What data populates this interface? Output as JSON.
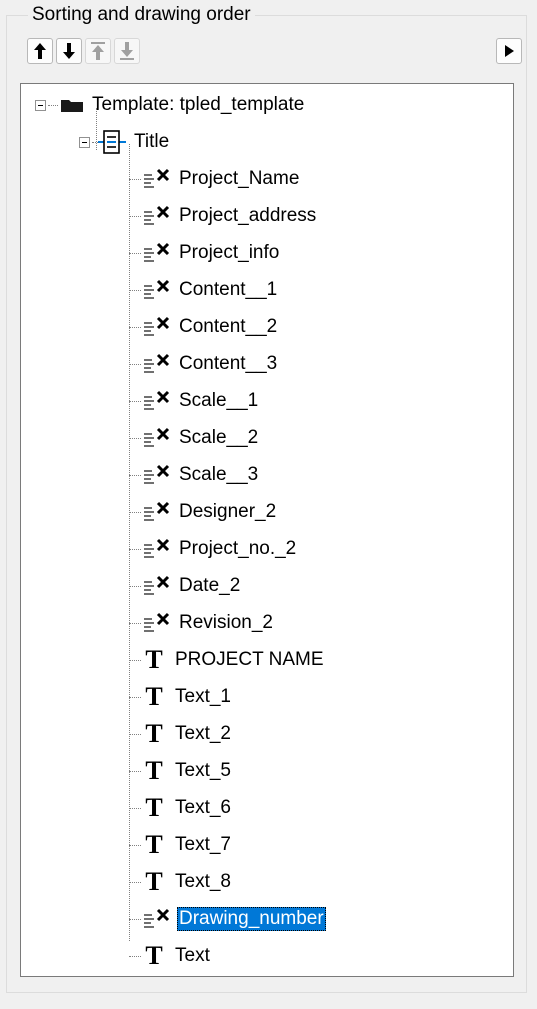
{
  "group": {
    "title": "Sorting and drawing order"
  },
  "toolbar": {
    "buttons": [
      {
        "name": "move-up-button",
        "icon": "arrow-up-icon",
        "enabled": true
      },
      {
        "name": "move-down-button",
        "icon": "arrow-down-icon",
        "enabled": true
      },
      {
        "name": "move-to-top-button",
        "icon": "arrow-to-top-icon",
        "enabled": false
      },
      {
        "name": "move-to-bottom-button",
        "icon": "arrow-to-bottom-icon",
        "enabled": false
      },
      {
        "name": "more-button",
        "icon": "play-right-icon",
        "enabled": true
      }
    ]
  },
  "tree": {
    "root": {
      "label": "Template: tpled_template",
      "icon": "folder-icon",
      "expanded": true
    },
    "title_node": {
      "label": "Title",
      "icon": "block-icon",
      "expanded": true
    },
    "items": [
      {
        "label": "Project_Name",
        "type": "field"
      },
      {
        "label": "Project_address",
        "type": "field"
      },
      {
        "label": "Project_info",
        "type": "field"
      },
      {
        "label": "Content__1",
        "type": "field"
      },
      {
        "label": "Content__2",
        "type": "field"
      },
      {
        "label": "Content__3",
        "type": "field"
      },
      {
        "label": "Scale__1",
        "type": "field"
      },
      {
        "label": "Scale__2",
        "type": "field"
      },
      {
        "label": "Scale__3",
        "type": "field"
      },
      {
        "label": "Designer_2",
        "type": "field"
      },
      {
        "label": "Project_no._2",
        "type": "field"
      },
      {
        "label": "Date_2",
        "type": "field"
      },
      {
        "label": "Revision_2",
        "type": "field"
      },
      {
        "label": "PROJECT NAME",
        "type": "text"
      },
      {
        "label": "Text_1",
        "type": "text"
      },
      {
        "label": "Text_2",
        "type": "text"
      },
      {
        "label": "Text_5",
        "type": "text"
      },
      {
        "label": "Text_6",
        "type": "text"
      },
      {
        "label": "Text_7",
        "type": "text"
      },
      {
        "label": "Text_8",
        "type": "text"
      },
      {
        "label": "Drawing_number",
        "type": "field",
        "selected": true
      },
      {
        "label": "Text",
        "type": "text"
      }
    ]
  },
  "colors": {
    "selection": "#0078d7",
    "enabled_icon": "#000000",
    "disabled_icon": "#a0a0a0"
  }
}
